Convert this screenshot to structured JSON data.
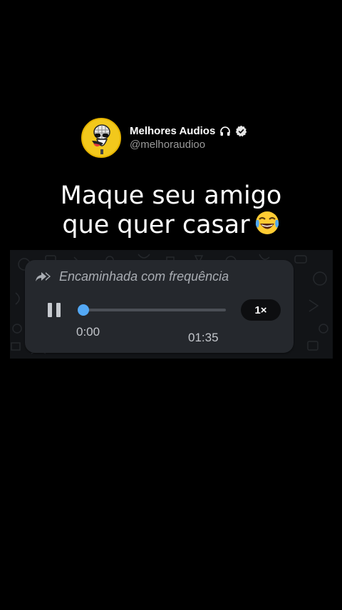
{
  "profile": {
    "name": "Melhores Audios",
    "handle": "@melhoraudioo",
    "avatar_icon": "laughing-microphone-mascot-icon",
    "headphone_icon": "headphones-icon",
    "verified_icon": "verified-badge-icon"
  },
  "headline": {
    "line1": "Maque seu amigo",
    "line2": "que quer casar",
    "emoji_icon": "tears-of-joy-emoji-icon"
  },
  "voice_message": {
    "forward_icon": "double-forward-arrow-icon",
    "forwarded_label": "Encaminhada com frequência",
    "play_state_icon": "pause-icon",
    "progress_fraction": 0.0,
    "current_time": "0:00",
    "duration": "01:35",
    "speed_label": "1×"
  },
  "colors": {
    "background": "#000000",
    "bubble": "#25282d",
    "accent": "#53a8f5",
    "avatar": "#f2c81c"
  }
}
